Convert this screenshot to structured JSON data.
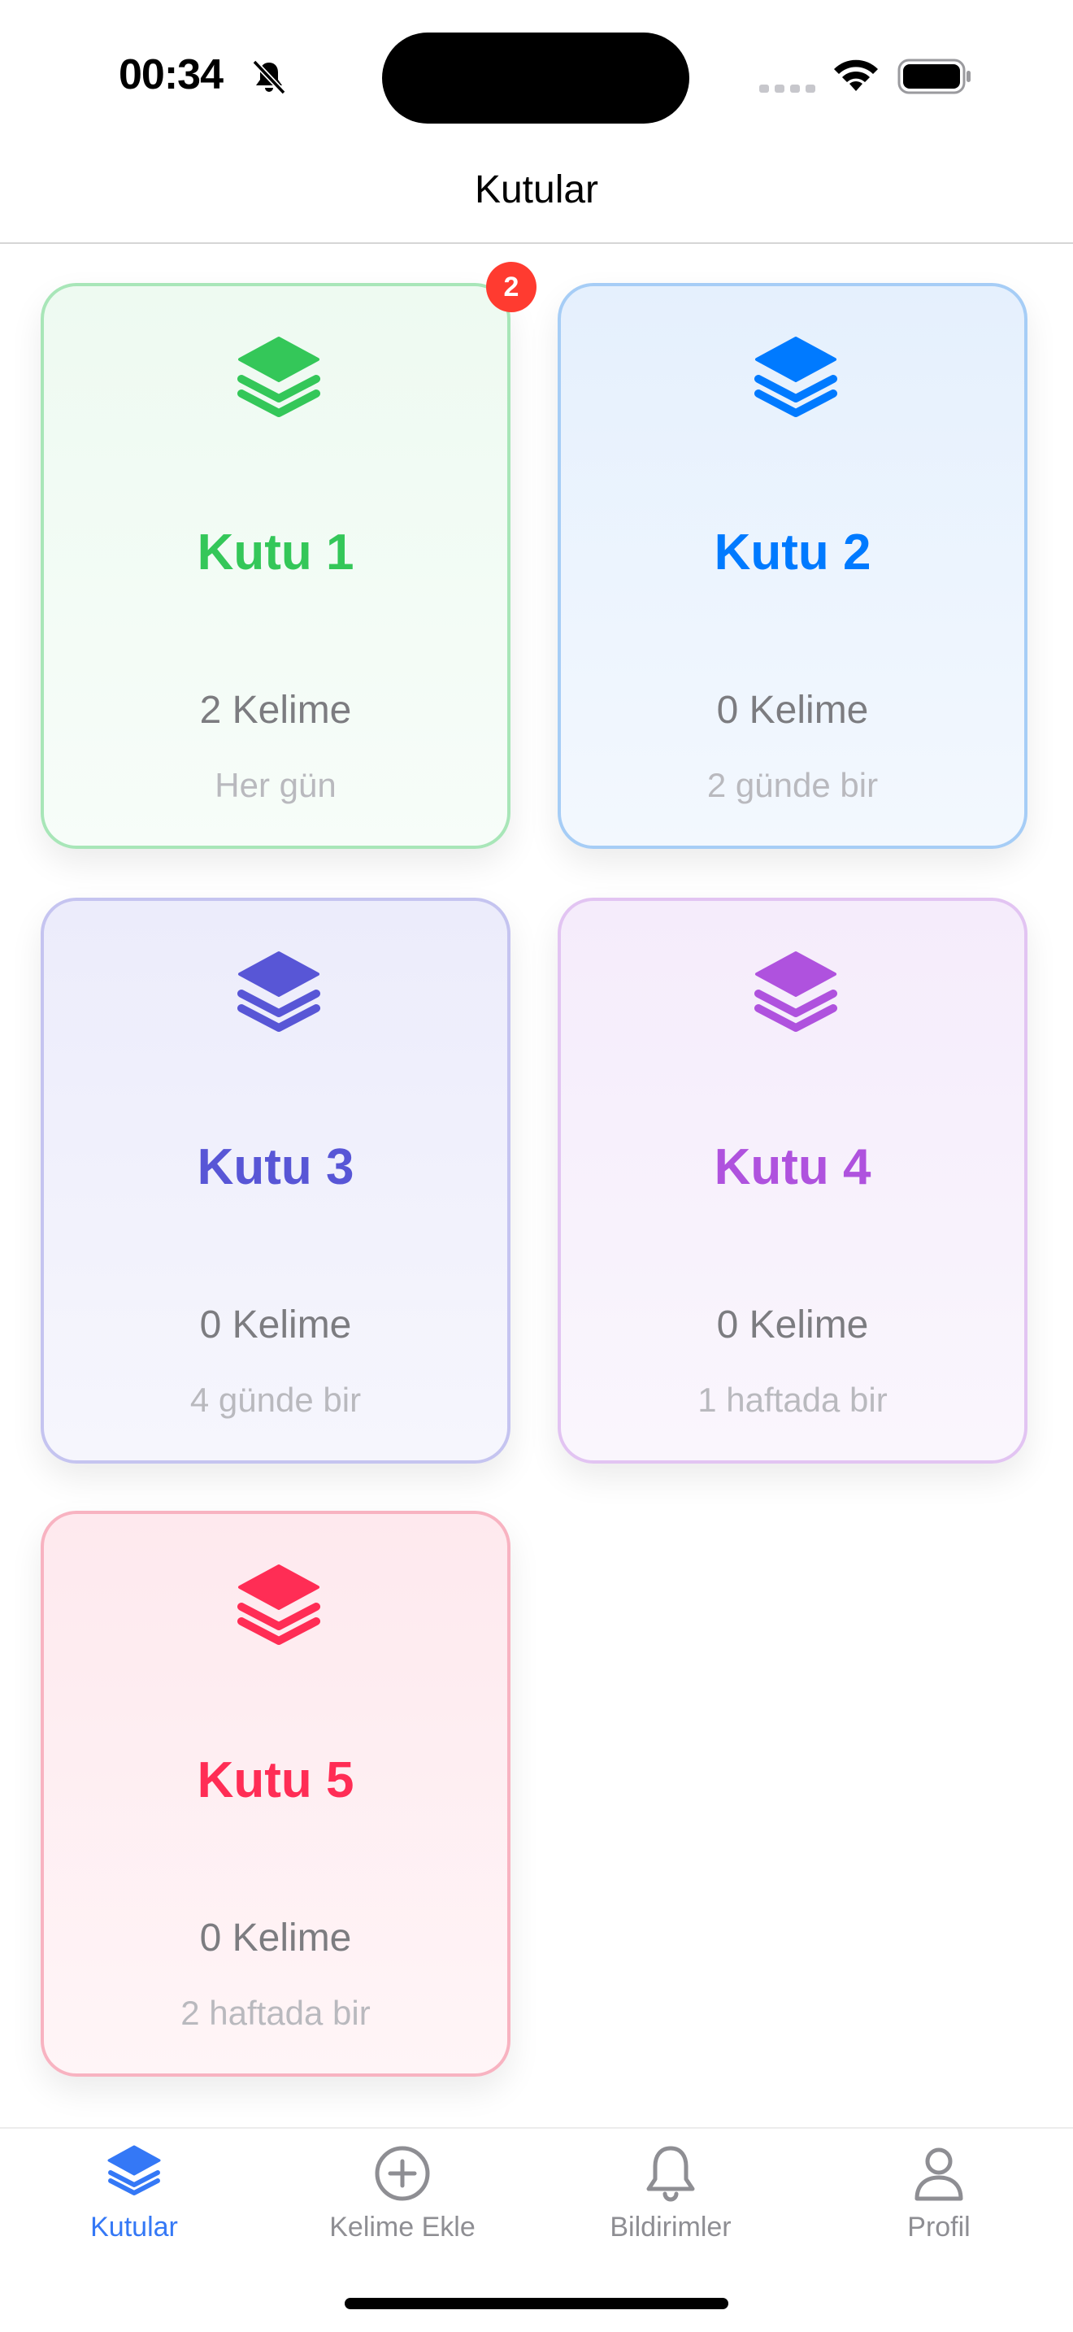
{
  "status_bar": {
    "time": "00:34"
  },
  "nav": {
    "title": "Kutular"
  },
  "boxes": [
    {
      "title": "Kutu 1",
      "count": "2 Kelime",
      "frequency": "Her gün",
      "color": "#34c759",
      "border": "#a8e6b8",
      "bg_top": "#eefaf1",
      "bg_bottom": "#f7fdf9",
      "badge": "2"
    },
    {
      "title": "Kutu 2",
      "count": "0 Kelime",
      "frequency": "2 günde bir",
      "color": "#007aff",
      "border": "#a6cdf6",
      "bg_top": "#e5f0fd",
      "bg_bottom": "#f3f8fe"
    },
    {
      "title": "Kutu 3",
      "count": "0 Kelime",
      "frequency": "4 günde bir",
      "color": "#5856d6",
      "border": "#c5c4f0",
      "bg_top": "#ececfb",
      "bg_bottom": "#f6f6fd"
    },
    {
      "title": "Kutu 4",
      "count": "0 Kelime",
      "frequency": "1 haftada bir",
      "color": "#af52de",
      "border": "#e2c4f2",
      "bg_top": "#f5ecfb",
      "bg_bottom": "#faf6fd"
    },
    {
      "title": "Kutu 5",
      "count": "0 Kelime",
      "frequency": "2 haftada bir",
      "color": "#ff2d55",
      "border": "#f8b3c1",
      "bg_top": "#fee9ee",
      "bg_bottom": "#fff5f7"
    }
  ],
  "tabs": [
    {
      "label": "Kutular",
      "icon": "stack-icon",
      "active": true
    },
    {
      "label": "Kelime Ekle",
      "icon": "plus-circle-icon",
      "active": false
    },
    {
      "label": "Bildirimler",
      "icon": "bell-icon",
      "active": false
    },
    {
      "label": "Profil",
      "icon": "person-icon",
      "active": false
    }
  ],
  "colors": {
    "accent": "#3478f6",
    "inactive": "#8e8e93"
  }
}
